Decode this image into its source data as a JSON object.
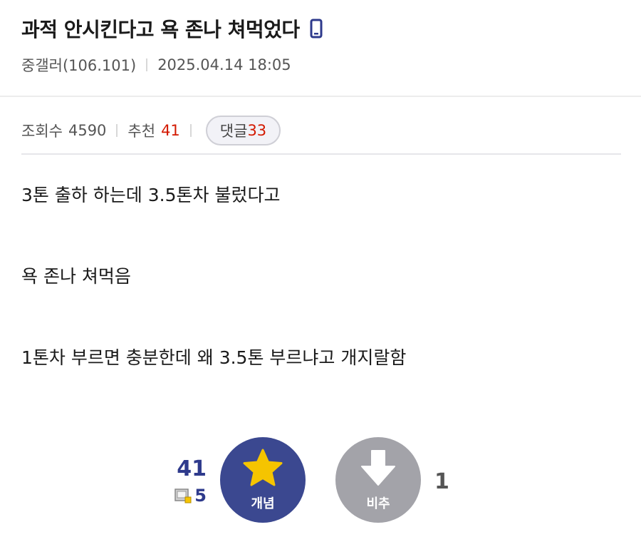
{
  "post": {
    "title": "과적 안시킨다고 욕 존나 쳐먹었다",
    "author": "중갤러(106.101)",
    "datetime": "2025.04.14 18:05"
  },
  "stats": {
    "views_label": "조회수",
    "views": "4590",
    "recommend_label": "추천",
    "recommend": "41",
    "comments_label": "댓글",
    "comments": "33"
  },
  "content": {
    "lines": [
      "3톤 출하 하는데 3.5톤차 불렀다고",
      "욕 존나 쳐먹음",
      "1톤차 부르면 충분한데 왜 3.5톤 부르냐고 개지랄함"
    ]
  },
  "vote": {
    "up_count": "41",
    "fixed_count": "5",
    "up_label": "개념",
    "down_label": "비추",
    "down_count": "1"
  },
  "colors": {
    "accent_red": "#d31900",
    "up_button": "#3b4890",
    "down_button": "#a3a3a9",
    "star": "#f5c400"
  },
  "icons": [
    "mobile-icon",
    "star-icon",
    "down-arrow-icon",
    "fixed-user-icon"
  ]
}
